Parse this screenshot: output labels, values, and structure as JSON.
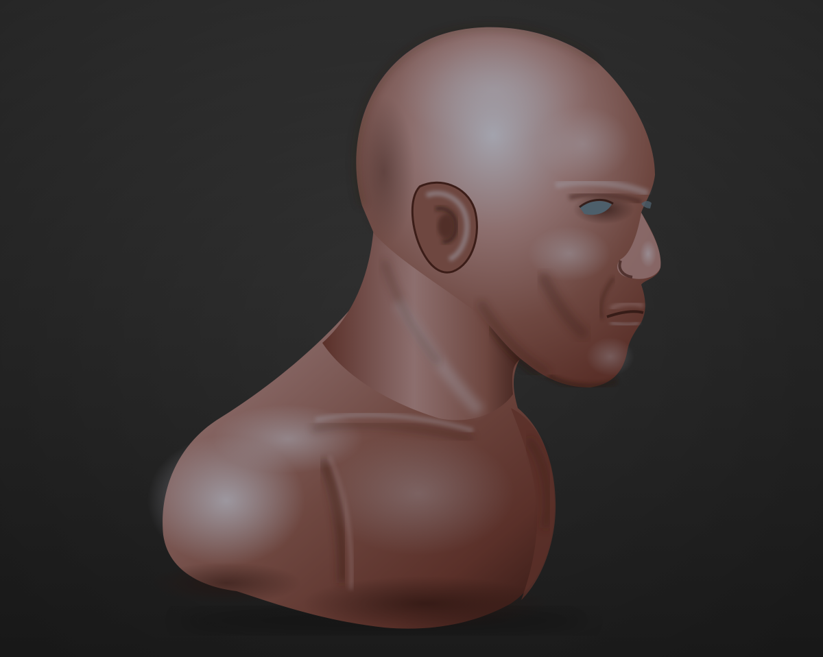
{
  "scene": {
    "background_top": "#393939",
    "background_bottom": "#232323",
    "material": {
      "highlight": "#a3a3ad",
      "light": "#8d6f6e",
      "mid": "#6e4740",
      "base": "#5a3029",
      "shadow": "#3b1d18",
      "deep_shadow": "#28130f"
    },
    "eye_color": "#4d5f6b",
    "subject": "sculpted-male-bust-icon"
  }
}
